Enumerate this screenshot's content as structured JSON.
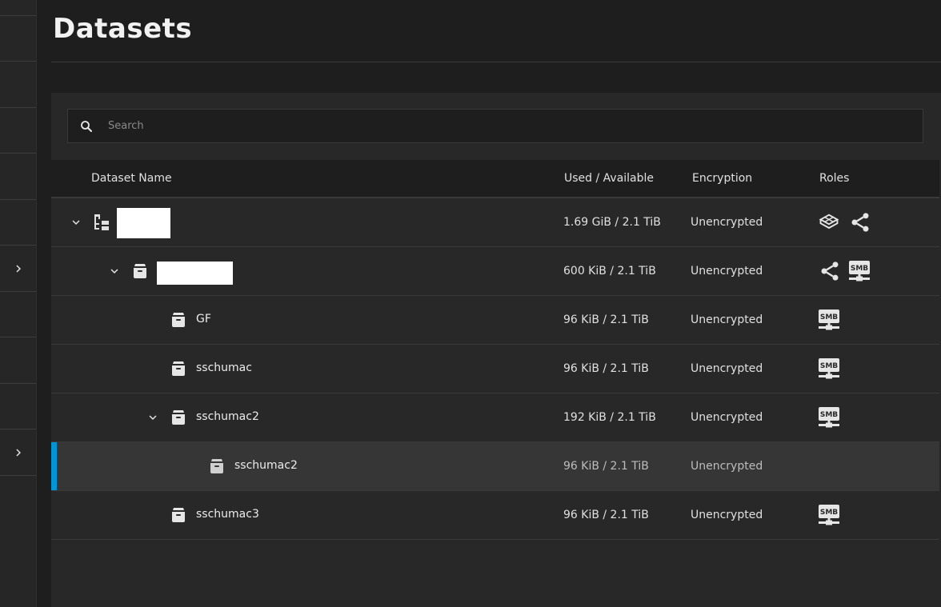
{
  "page": {
    "title": "Datasets"
  },
  "search": {
    "placeholder": "Search",
    "icon": "search-icon"
  },
  "table": {
    "headers": {
      "name": "Dataset Name",
      "used": "Used / Available",
      "encryption": "Encryption",
      "roles": "Roles"
    },
    "rows": [
      {
        "name": "",
        "redacted": true,
        "used": "1.69 GiB / 2.1 TiB",
        "encryption": "Unencrypted",
        "level": 0,
        "expanded": true,
        "icon": "pool-tree-icon",
        "roles": [
          "apps-cube-icon",
          "share-icon"
        ]
      },
      {
        "name": "",
        "redacted": true,
        "used": "600 KiB / 2.1 TiB",
        "encryption": "Unencrypted",
        "level": 1,
        "expanded": true,
        "icon": "dataset-icon",
        "roles": [
          "share-icon",
          "smb-icon"
        ]
      },
      {
        "name": "GF",
        "used": "96 KiB / 2.1 TiB",
        "encryption": "Unencrypted",
        "level": 2,
        "icon": "dataset-icon",
        "roles": [
          "smb-icon"
        ]
      },
      {
        "name": "sschumac",
        "used": "96 KiB / 2.1 TiB",
        "encryption": "Unencrypted",
        "level": 2,
        "icon": "dataset-icon",
        "roles": [
          "smb-icon"
        ]
      },
      {
        "name": "sschumac2",
        "used": "192 KiB / 2.1 TiB",
        "encryption": "Unencrypted",
        "level": 2,
        "expanded": true,
        "icon": "dataset-icon",
        "roles": [
          "smb-icon"
        ]
      },
      {
        "name": "sschumac2",
        "used": "96 KiB / 2.1 TiB",
        "encryption": "Unencrypted",
        "level": 3,
        "selected": true,
        "icon": "dataset-icon",
        "roles": []
      },
      {
        "name": "sschumac3",
        "used": "96 KiB / 2.1 TiB",
        "encryption": "Unencrypted",
        "level": 2,
        "icon": "dataset-icon",
        "roles": [
          "smb-icon"
        ]
      }
    ]
  },
  "roles_text": {
    "smb": "SMB"
  },
  "colors": {
    "background": "#1e1e1e",
    "panel": "#282828",
    "selected_row": "#363636",
    "accent": "#0095d5",
    "text": "#e6e6e6"
  }
}
